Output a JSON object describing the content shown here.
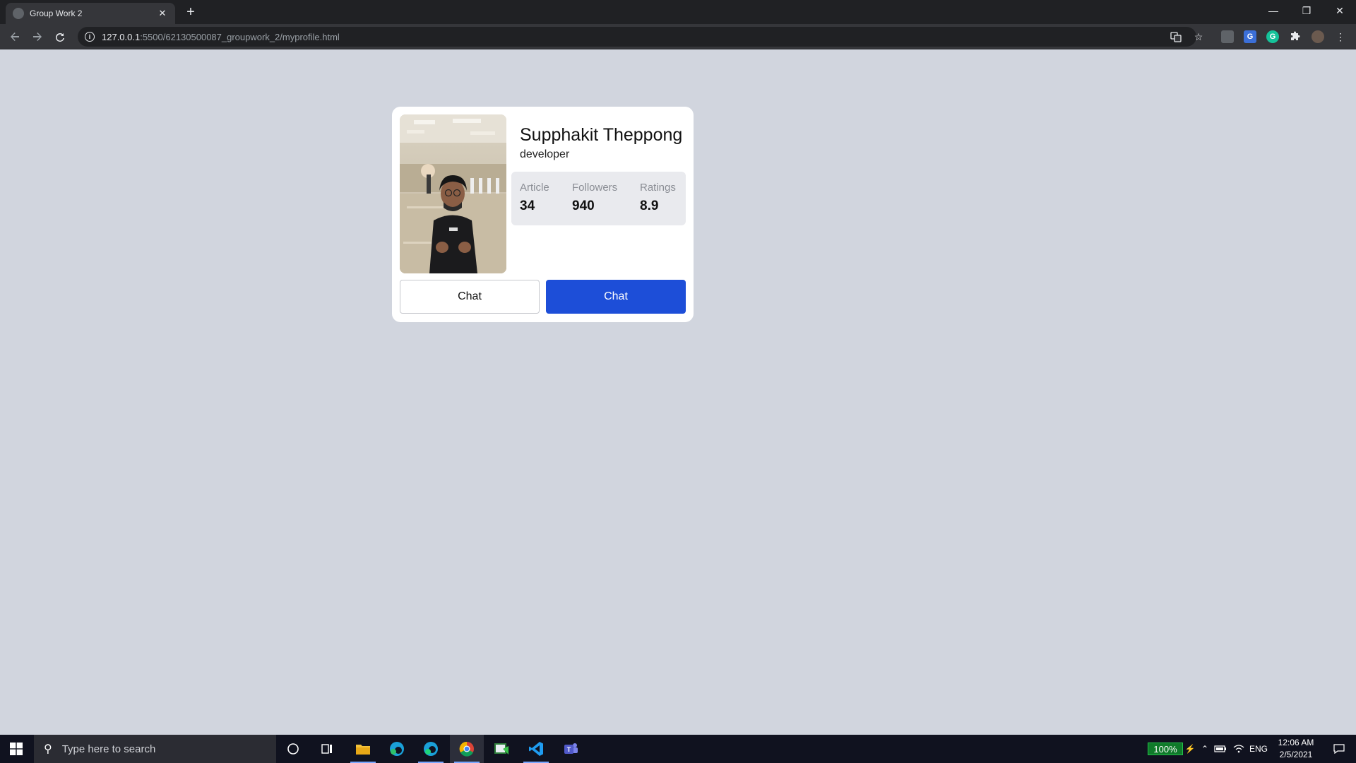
{
  "browser": {
    "tab_title": "Group Work 2",
    "tab_close": "✕",
    "new_tab": "+",
    "url_host": "127.0.0.1",
    "url_path": ":5500/62130500087_groupwork_2/myprofile.html",
    "window_controls": {
      "minimize": "—",
      "restore": "❐",
      "close": "✕"
    }
  },
  "profile": {
    "name": "Supphakit Theppong",
    "role": "developer",
    "stats": [
      {
        "label": "Article",
        "value": "34"
      },
      {
        "label": "Followers",
        "value": "940"
      },
      {
        "label": "Ratings",
        "value": "8.9"
      }
    ],
    "buttons": {
      "outline_label": "Chat",
      "primary_label": "Chat"
    }
  },
  "taskbar": {
    "search_placeholder": "Type here to search",
    "battery_percent": "100%",
    "language": "ENG",
    "time": "12:06 AM",
    "date": "2/5/2021"
  },
  "colors": {
    "page_bg": "#d1d5de",
    "primary_button": "#1d4ed8",
    "stats_bg": "#e9eaee"
  }
}
